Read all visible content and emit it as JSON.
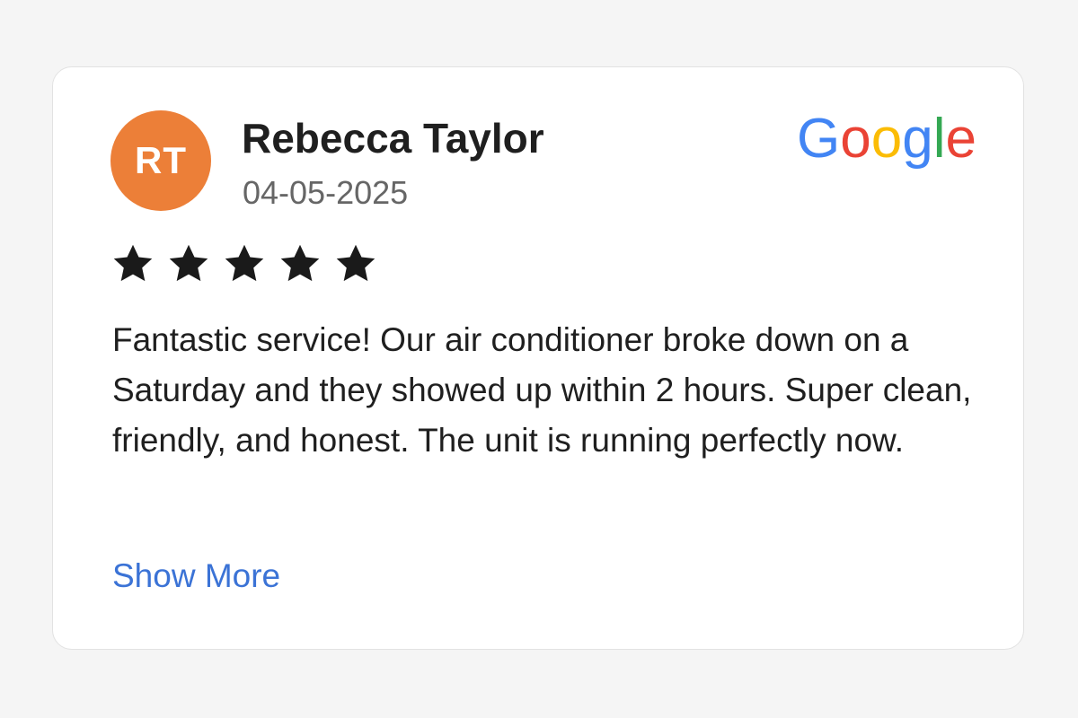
{
  "review": {
    "author_initials": "RT",
    "author_name": "Rebecca Taylor",
    "date": "04-05-2025",
    "rating": 5,
    "rating_max": 5,
    "star_icon": "star-icon",
    "text": "Fantastic service! Our air conditioner broke down on a Saturday and they showed up within 2 hours. Super clean, friendly, and honest. The unit is running perfectly now.",
    "show_more_label": "Show More"
  },
  "brand": {
    "letters": [
      "G",
      "o",
      "o",
      "g",
      "l",
      "e"
    ],
    "letter_colors": [
      "#4285F4",
      "#EA4335",
      "#FBBC05",
      "#4285F4",
      "#34A853",
      "#EA4335"
    ]
  },
  "colors": {
    "avatar_bg": "#ec7f38",
    "link": "#3b73d6",
    "star": "#1a1a1a"
  }
}
